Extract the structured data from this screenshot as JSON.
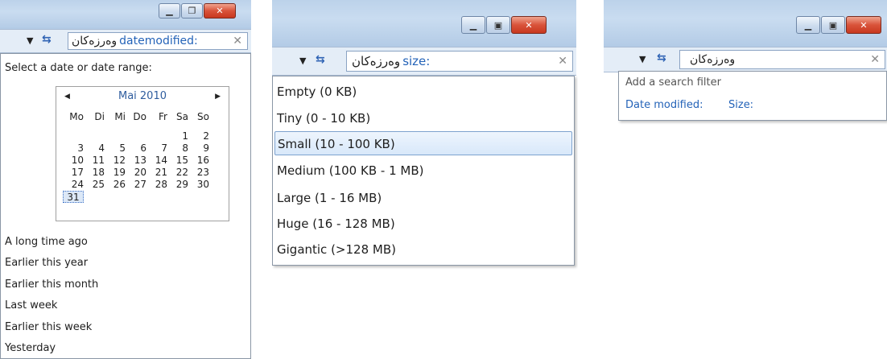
{
  "panel_date": {
    "search": {
      "rtl_text": "وەرزەکان",
      "token": "datemodified:"
    },
    "prompt": "Select a date or date range:",
    "calendar": {
      "month_label": "Mai 2010",
      "weekdays": [
        "Mo",
        "Di",
        "Mi",
        "Do",
        "Fr",
        "Sa",
        "So"
      ],
      "weeks": [
        [
          "",
          "",
          "",
          "",
          "",
          "1",
          "2"
        ],
        [
          "3",
          "4",
          "5",
          "6",
          "7",
          "8",
          "9"
        ],
        [
          "10",
          "11",
          "12",
          "13",
          "14",
          "15",
          "16"
        ],
        [
          "17",
          "18",
          "19",
          "20",
          "21",
          "22",
          "23"
        ],
        [
          "24",
          "25",
          "26",
          "27",
          "28",
          "29",
          "30"
        ],
        [
          "31",
          "",
          "",
          "",
          "",
          "",
          ""
        ]
      ],
      "selected_day": "31"
    },
    "options": [
      "A long time ago",
      "Earlier this year",
      "Earlier this month",
      "Last week",
      "Earlier this week",
      "Yesterday"
    ]
  },
  "panel_size": {
    "search": {
      "rtl_text": "وەرزەکان",
      "token": "size:"
    },
    "options": [
      "Empty (0 KB)",
      "Tiny (0 - 10 KB)",
      "Small (10 - 100 KB)",
      "Medium (100 KB - 1 MB)",
      "Large (1 - 16 MB)",
      "Huge (16 - 128 MB)",
      "Gigantic (>128 MB)"
    ],
    "selected": "Small (10 - 100 KB)"
  },
  "panel_filter": {
    "search": {
      "rtl_text": "وەرزەکان",
      "token": ""
    },
    "heading": "Add a search filter",
    "filters": [
      "Date modified:",
      "Size:"
    ]
  },
  "icons": {
    "minimize": "minimize-icon",
    "maximize": "maximize-icon",
    "restore": "restore-icon",
    "close": "close-icon",
    "dropdown": "chevron-down-icon",
    "refresh": "refresh-icon",
    "clear": "clear-search-icon"
  }
}
